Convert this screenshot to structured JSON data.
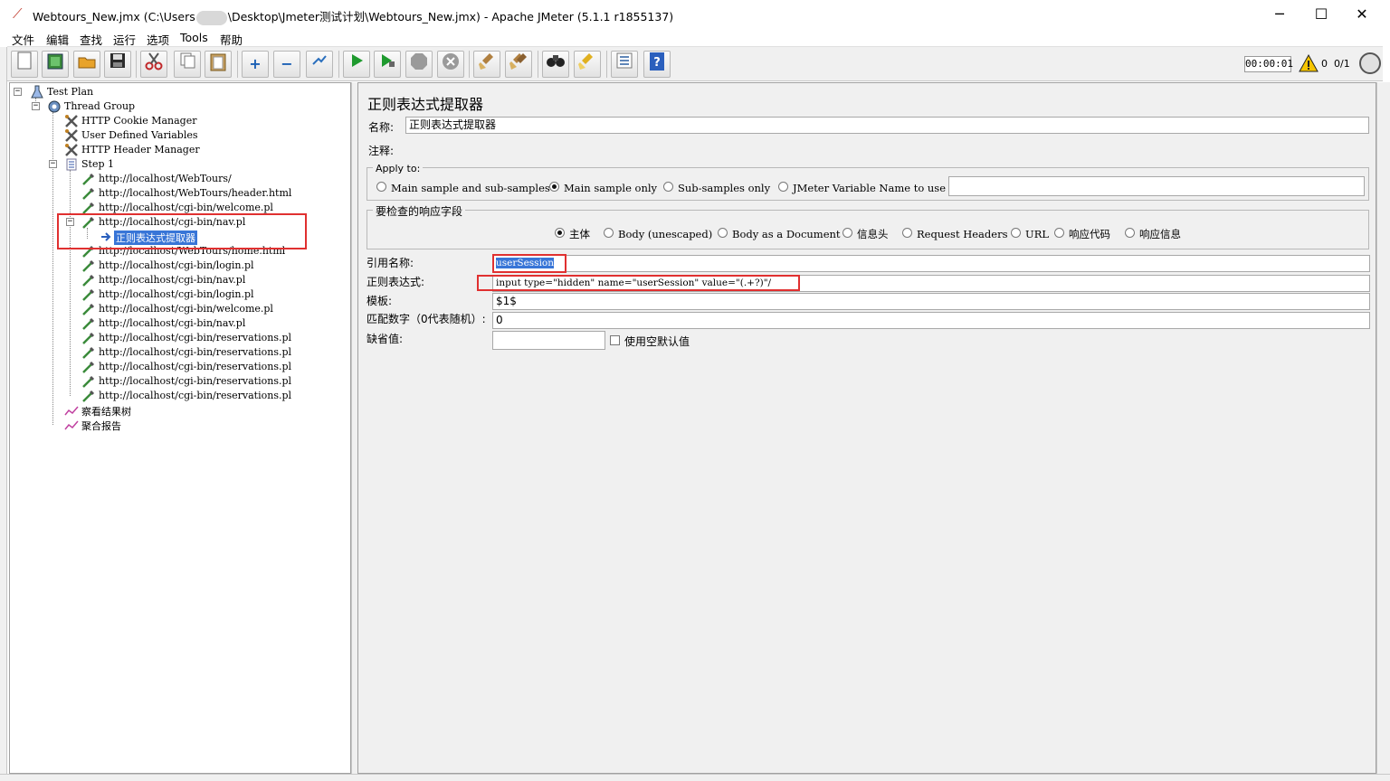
{
  "window": {
    "title_prefix": "Webtours_New.jmx (C:\\Users",
    "title_suffix": "\\Desktop\\Jmeter测试计划\\Webtours_New.jmx) - Apache JMeter (5.1.1 r1855137)",
    "minimize": "─",
    "maximize": "☐",
    "close": "✕"
  },
  "menu": [
    "文件",
    "编辑",
    "查找",
    "运行",
    "选项",
    "Tools",
    "帮助"
  ],
  "toolbar": {
    "icons": [
      "new-icon",
      "templates-icon",
      "open-icon",
      "save-icon",
      "cut-icon",
      "copy-icon",
      "paste-icon",
      "expand-icon",
      "collapse-icon",
      "toggle-icon",
      "start-icon",
      "start-no-pause-icon",
      "stop-icon",
      "shutdown-icon",
      "clear-icon",
      "clear-all-icon",
      "search-icon",
      "reset-search-icon",
      "function-helper-icon",
      "help-icon"
    ],
    "timer": "00:00:01",
    "warning_count": "0",
    "threads": "0/1"
  },
  "tree": {
    "test_plan": "Test Plan",
    "thread_group": "Thread Group",
    "cookie_manager": "HTTP Cookie Manager",
    "user_vars": "User Defined Variables",
    "header_manager": "HTTP Header Manager",
    "step": "Step 1",
    "samplers": [
      "http://localhost/WebTours/",
      "http://localhost/WebTours/header.html",
      "http://localhost/cgi-bin/welcome.pl",
      "http://localhost/cgi-bin/nav.pl",
      "http://localhost/WebTours/home.html",
      "http://localhost/cgi-bin/login.pl",
      "http://localhost/cgi-bin/nav.pl",
      "http://localhost/cgi-bin/login.pl",
      "http://localhost/cgi-bin/welcome.pl",
      "http://localhost/cgi-bin/nav.pl",
      "http://localhost/cgi-bin/reservations.pl",
      "http://localhost/cgi-bin/reservations.pl",
      "http://localhost/cgi-bin/reservations.pl",
      "http://localhost/cgi-bin/reservations.pl",
      "http://localhost/cgi-bin/reservations.pl"
    ],
    "selected_child": "正则表达式提取器",
    "listener_tree": "察看结果树",
    "listener_aggregate": "聚合报告"
  },
  "editor": {
    "title": "正则表达式提取器",
    "name_label": "名称:",
    "name_value": "正则表达式提取器",
    "comment_label": "注释:",
    "comment_value": "",
    "apply_to": {
      "legend": "Apply to:",
      "options": [
        "Main sample and sub-samples",
        "Main sample only",
        "Sub-samples only",
        "JMeter Variable Name to use"
      ],
      "selected": "Main sample only",
      "variable_value": ""
    },
    "response_field": {
      "legend": "要检查的响应字段",
      "options": [
        "主体",
        "Body (unescaped)",
        "Body as a Document",
        "信息头",
        "Request Headers",
        "URL",
        "响应代码",
        "响应信息"
      ],
      "selected": "主体"
    },
    "ref_name_label": "引用名称:",
    "ref_name_value": "userSession",
    "regex_label": "正则表达式:",
    "regex_value": "input type=\"hidden\" name=\"userSession\" value=\"(.+?)\"/",
    "template_label": "模板:",
    "template_value": "$1$",
    "match_no_label": "匹配数字（0代表随机）:",
    "match_no_value": "0",
    "default_label": "缺省值:",
    "default_value": "",
    "use_empty_label": "使用空默认值",
    "use_empty_checked": false
  },
  "colors": {
    "selection": "#3875d7",
    "highlight_box": "#e03030",
    "panel_bg": "#f0f0f0"
  }
}
